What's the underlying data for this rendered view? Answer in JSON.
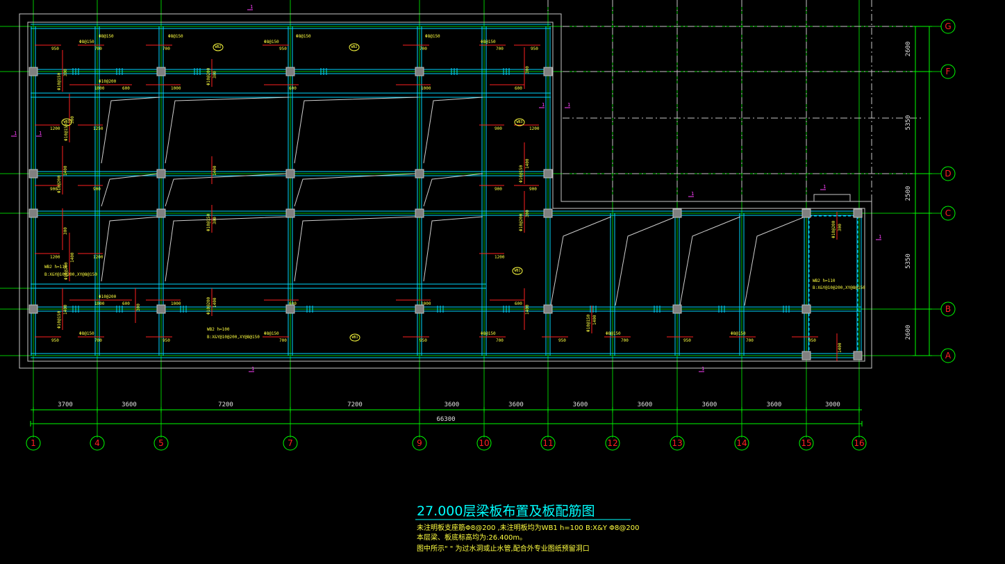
{
  "grid": {
    "rows": [
      {
        "label": "G",
        "color": "#ff2020"
      },
      {
        "label": "F",
        "color": "#ff2020"
      },
      {
        "label": "D",
        "color": "#ff2020"
      },
      {
        "label": "C",
        "color": "#ff2020"
      },
      {
        "label": "B",
        "color": "#ff2020"
      },
      {
        "label": "A",
        "color": "#ff2020"
      }
    ],
    "columns": [
      "1",
      "4",
      "5",
      "7",
      "9",
      "10",
      "11",
      "12",
      "13",
      "14",
      "15",
      "16"
    ],
    "column_spacings": [
      "3700",
      "3600",
      "7200",
      "7200",
      "3600",
      "3600",
      "3600",
      "3600",
      "3600",
      "3600",
      "3000"
    ],
    "total_length": "66300",
    "row_spacings": [
      "2600",
      "5350",
      "2500",
      "5350",
      "2600"
    ]
  },
  "slab_tags": [
    "WB2",
    "WB2",
    "WB3",
    "WB3",
    "WB1",
    "WB1"
  ],
  "rebar_labels": {
    "a": "Φ8@150",
    "b": "Φ10@150",
    "c": "Φ10@200",
    "d": "Φ12@150",
    "e": "Φ10@200"
  },
  "rebar_dims": [
    "950",
    "700",
    "1000",
    "1200",
    "1250",
    "900",
    "1400",
    "1150",
    "600",
    "300"
  ],
  "local_notes": {
    "wb_note_1": "WB2 h=110",
    "wb_note_1b": "B:X&Y@10@200,XY@8@150",
    "wb_note_2": "WB2 h=100",
    "wb_note_2b": "B:X&Y@10@200,XY@8@150",
    "wb_note_3": "WB2 h=110",
    "wb_note_3b": "B:X&Y@10@200,XY@8@150"
  },
  "section_mark": "1",
  "title": {
    "heading": "27.000层梁板布置及板配筋图",
    "note1": "未注明板支座筋Φ8@200 ,未注明板均为WB1  h=100  B:X&Y Φ8@200",
    "note2": "本层梁、板底标高均为:26.400m。",
    "note3": "图中所示\"   \" 为过水洞或止水管,配合外专业图纸预留洞口"
  },
  "colors": {
    "grid": "#00c800",
    "beam": "#00d8ff",
    "rebar": "#ff2020",
    "text": "#ffff40",
    "title": "#00ffff",
    "section": "#ff40ff"
  }
}
